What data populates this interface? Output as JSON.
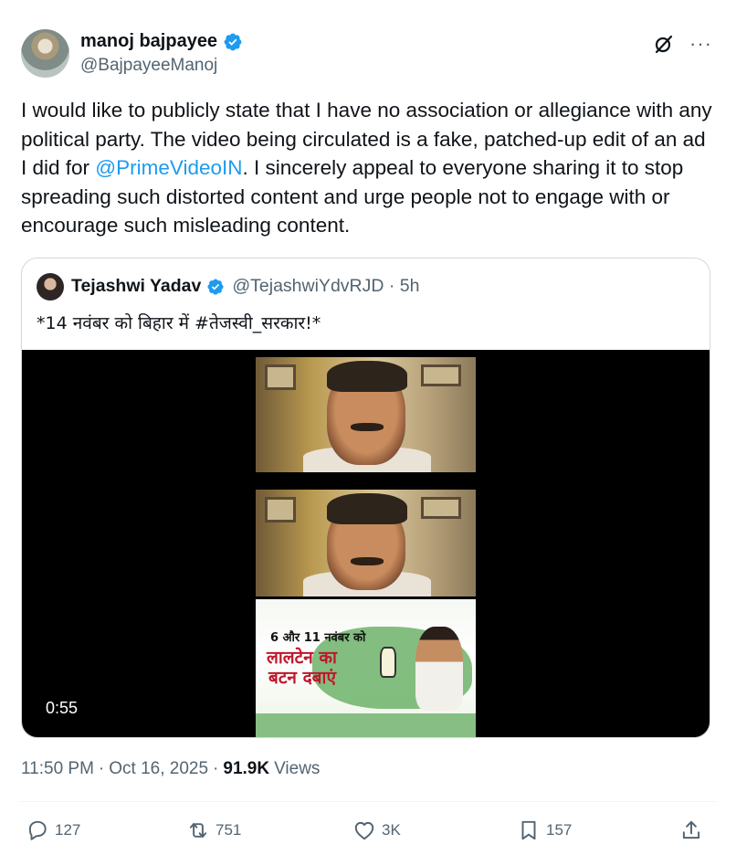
{
  "author": {
    "display_name": "manoj bajpayee",
    "handle": "@BajpayeeManoj"
  },
  "tweet": {
    "text_before_mention": "I would like to publicly state that I have no association or allegiance with any political party. The video being circulated is a fake, patched-up edit of an ad I did for ",
    "mention": "@PrimeVideoIN",
    "text_after_mention": ". I sincerely appeal to everyone sharing it to stop spreading such distorted content and urge people not to engage with or encourage such misleading content."
  },
  "quoted_tweet": {
    "display_name": "Tejashwi Yadav",
    "handle_time": "@TejashwiYdvRJD · 5h",
    "text": "*14 नवंबर को बिहार में #तेजस्वी_सरकार!*",
    "video": {
      "duration": "0:55",
      "poster_line1": "6 और 11 नवंबर को",
      "poster_line2": "लालटेन का",
      "poster_line3": "बटन दबाएं"
    }
  },
  "meta": {
    "time": "11:50 PM",
    "sep1": "·",
    "date": "Oct 16, 2025",
    "sep2": "·",
    "views_count": "91.9K",
    "views_label": "Views"
  },
  "actions": {
    "replies": "127",
    "reposts": "751",
    "likes": "3K",
    "bookmarks": "157"
  },
  "icons": {
    "verified": "verified-badge-icon",
    "grok": "grok-icon",
    "more": "more-icon",
    "reply": "reply-icon",
    "repost": "repost-icon",
    "like": "heart-icon",
    "bookmark": "bookmark-icon",
    "share": "share-icon"
  },
  "colors": {
    "accent": "#1d9bf0",
    "text": "#0f1419",
    "secondary": "#536471"
  }
}
